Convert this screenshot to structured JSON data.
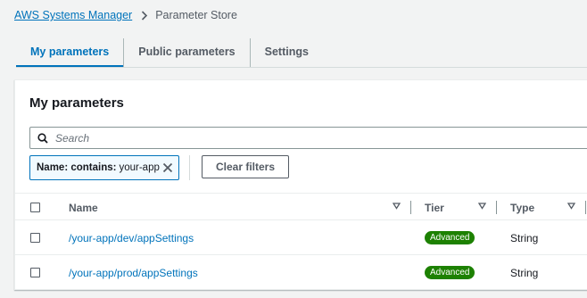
{
  "breadcrumb": {
    "root": "AWS Systems Manager",
    "current": "Parameter Store"
  },
  "tabs": [
    {
      "label": "My parameters",
      "active": true
    },
    {
      "label": "Public parameters",
      "active": false
    },
    {
      "label": "Settings",
      "active": false
    }
  ],
  "panel": {
    "title": "My parameters",
    "search_placeholder": "Search",
    "filter_token": {
      "key": "Name: contains:",
      "value": "your-app"
    },
    "clear_filters_label": "Clear filters"
  },
  "table": {
    "columns": [
      "Name",
      "Tier",
      "Type"
    ],
    "rows": [
      {
        "name": "/your-app/dev/appSettings",
        "tier": "Advanced",
        "type": "String"
      },
      {
        "name": "/your-app/prod/appSettings",
        "tier": "Advanced",
        "type": "String"
      }
    ]
  },
  "colors": {
    "link": "#0073bb",
    "badge_success": "#1d8102"
  },
  "icons": {
    "breadcrumb_separator": "chevron-right-icon",
    "search": "search-icon",
    "token_close": "close-icon",
    "sort": "caret-down-icon"
  }
}
